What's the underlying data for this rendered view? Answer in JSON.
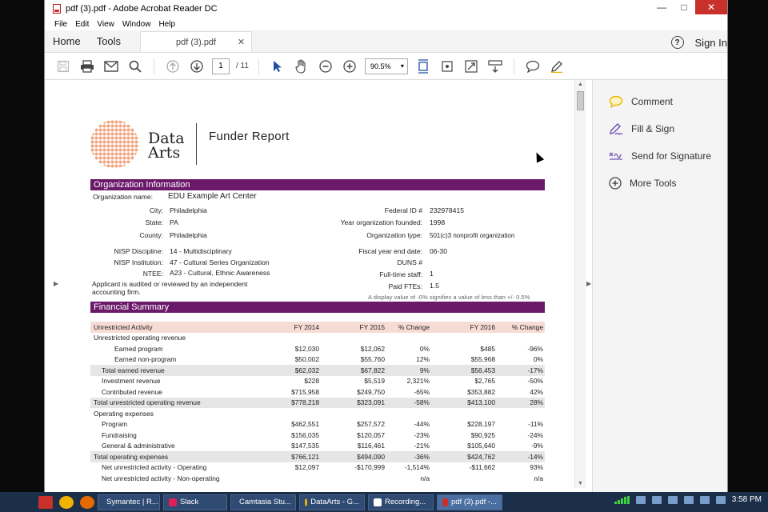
{
  "window": {
    "title": "pdf (3).pdf - Adobe Acrobat Reader DC",
    "controls": {
      "minimize": "—",
      "maximize": "□",
      "close": "✕"
    }
  },
  "menu": [
    "File",
    "Edit",
    "View",
    "Window",
    "Help"
  ],
  "tabs": {
    "home": "Home",
    "tools": "Tools",
    "document": "pdf (3).pdf",
    "sign_in": "Sign In",
    "help": "?"
  },
  "toolbar": {
    "page_current": "1",
    "page_total": "/ 11",
    "zoom": "90.5%"
  },
  "side_panel": [
    {
      "label": "Comment",
      "icon": "comment-icon"
    },
    {
      "label": "Fill & Sign",
      "icon": "fill-sign-icon"
    },
    {
      "label": "Send for Signature",
      "icon": "send-signature-icon"
    },
    {
      "label": "More Tools",
      "icon": "plus-circle-icon"
    }
  ],
  "report": {
    "logo_line1": "Data",
    "logo_line2": "Arts",
    "title": "Funder Report",
    "org_section": "Organization Information",
    "org_name_label": "Organization name:",
    "org_name": "EDU Example Art Center",
    "left_fields": [
      {
        "label": "City:",
        "value": "Philadelphia"
      },
      {
        "label": "State:",
        "value": "PA"
      },
      {
        "label": "County:",
        "value": "Philadelphia"
      },
      {
        "label": "NISP Discipline:",
        "value": "14 - Multidisciplinary"
      },
      {
        "label": "NISP Institution:",
        "value": "47 - Cultural Series Organization"
      },
      {
        "label": "NTEE:",
        "value": "A23 - Cultural, Ethnic Awareness"
      }
    ],
    "right_fields": [
      {
        "label": "Federal ID #",
        "value": "232978415"
      },
      {
        "label": "Year organization founded:",
        "value": "1998"
      },
      {
        "label": "Organization type:",
        "value": "501(c)3 nonprofit organization"
      },
      {
        "label": "Fiscal year end date:",
        "value": "06-30"
      },
      {
        "label": "DUNS #",
        "value": ""
      },
      {
        "label": "Full-time staff:",
        "value": "1"
      },
      {
        "label": "Paid FTEs:",
        "value": "1.5"
      }
    ],
    "audit_note_1": "Applicant is audited or reviewed by an independent",
    "audit_note_2": "accounting firm.",
    "display_note": "A display value of -0% signifies a value of less than +/- 0.5%",
    "fin_section": "Financial Summary",
    "fin_headers": [
      "Unrestricted Activity",
      "FY 2014",
      "FY 2015",
      "% Change",
      "FY 2016",
      "% Change"
    ],
    "fin_rows": [
      {
        "label": "Unrestricted operating revenue",
        "cells": [
          "",
          "",
          "",
          "",
          ""
        ],
        "indent": 0,
        "type": "normal"
      },
      {
        "label": "Earned program",
        "cells": [
          "$12,030",
          "$12,062",
          "0%",
          "$485",
          "-96%"
        ],
        "indent": 2,
        "type": "normal"
      },
      {
        "label": "Earned non-program",
        "cells": [
          "$50,002",
          "$55,760",
          "12%",
          "$55,968",
          "0%"
        ],
        "indent": 2,
        "type": "normal"
      },
      {
        "label": "Total earned revenue",
        "cells": [
          "$62,032",
          "$67,822",
          "9%",
          "$56,453",
          "-17%"
        ],
        "indent": 1,
        "type": "tot"
      },
      {
        "label": "Investment revenue",
        "cells": [
          "$228",
          "$5,519",
          "2,321%",
          "$2,765",
          "-50%"
        ],
        "indent": 1,
        "type": "normal"
      },
      {
        "label": "Contributed revenue",
        "cells": [
          "$715,958",
          "$249,750",
          "-65%",
          "$353,882",
          "42%"
        ],
        "indent": 1,
        "type": "normal"
      },
      {
        "label": "Total unrestricted operating revenue",
        "cells": [
          "$778,218",
          "$323,091",
          "-58%",
          "$413,100",
          "28%"
        ],
        "indent": 0,
        "type": "tot"
      },
      {
        "label": "Operating expenses",
        "cells": [
          "",
          "",
          "",
          "",
          ""
        ],
        "indent": 0,
        "type": "normal"
      },
      {
        "label": "Program",
        "cells": [
          "$462,551",
          "$257,572",
          "-44%",
          "$228,197",
          "-11%"
        ],
        "indent": 1,
        "type": "normal"
      },
      {
        "label": "Fundraising",
        "cells": [
          "$156,035",
          "$120,057",
          "-23%",
          "$90,925",
          "-24%"
        ],
        "indent": 1,
        "type": "normal"
      },
      {
        "label": "General & administrative",
        "cells": [
          "$147,535",
          "$116,461",
          "-21%",
          "$105,640",
          "-9%"
        ],
        "indent": 1,
        "type": "normal"
      },
      {
        "label": "Total operating expenses",
        "cells": [
          "$766,121",
          "$494,090",
          "-36%",
          "$424,762",
          "-14%"
        ],
        "indent": 0,
        "type": "tot"
      },
      {
        "label": "Net unrestricted activity - Operating",
        "cells": [
          "$12,097",
          "-$170,999",
          "-1,514%",
          "-$11,662",
          "93%"
        ],
        "indent": 1,
        "type": "normal"
      },
      {
        "label": "Net unrestricted activity - Non-operating",
        "cells": [
          "",
          "",
          "n/a",
          "",
          "n/a"
        ],
        "indent": 1,
        "type": "normal"
      }
    ]
  },
  "taskbar": {
    "items": [
      "Symantec | R...",
      "Slack",
      "Camtasia Stu...",
      "DataArts - G...",
      "Recording...",
      "pdf (3).pdf -..."
    ],
    "clock": "3:58 PM"
  },
  "colors": {
    "section_bar": "#6b1a6a",
    "header_row": "#f7dcd6",
    "total_row": "#e6e6e6",
    "taskbar": "#1c2f4a",
    "close_button": "#c9302c",
    "logo": "#f0a37a"
  }
}
